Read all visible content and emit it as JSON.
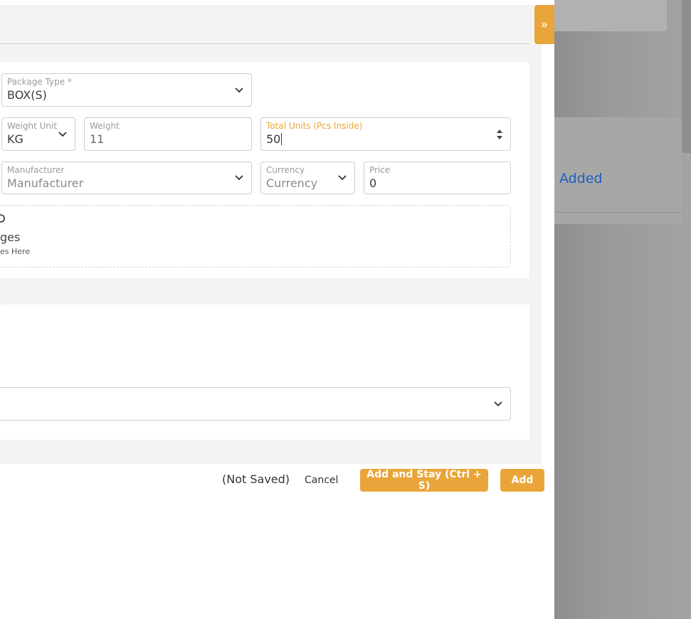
{
  "background": {
    "added_text": "Added"
  },
  "drawer": {
    "toggle_glyph": "»",
    "fields": {
      "package_type": {
        "label": "Package Type *",
        "value": "BOX(S)"
      },
      "weight_unit": {
        "label": "Weight Unit",
        "value": "KG"
      },
      "weight": {
        "label": "Weight",
        "value": "11"
      },
      "total_units": {
        "label": "Total Units (Pcs Inside)",
        "value": "50"
      },
      "manufacturer": {
        "label": "Manufacturer",
        "placeholder": "Manufacturer"
      },
      "currency": {
        "label": "Currency",
        "placeholder": "Currency"
      },
      "price": {
        "label": "Price",
        "value": "0"
      }
    },
    "dropzone": {
      "title_fragment": "ges",
      "subtitle_fragment": "es Here"
    }
  },
  "footer": {
    "status": "(Not Saved)",
    "cancel_label": "Cancel",
    "add_and_stay_label": "Add and Stay (Ctrl + S)",
    "add_label": "Add"
  },
  "colors": {
    "accent": "#e9a53a",
    "link_blue": "#1f5fbf"
  }
}
